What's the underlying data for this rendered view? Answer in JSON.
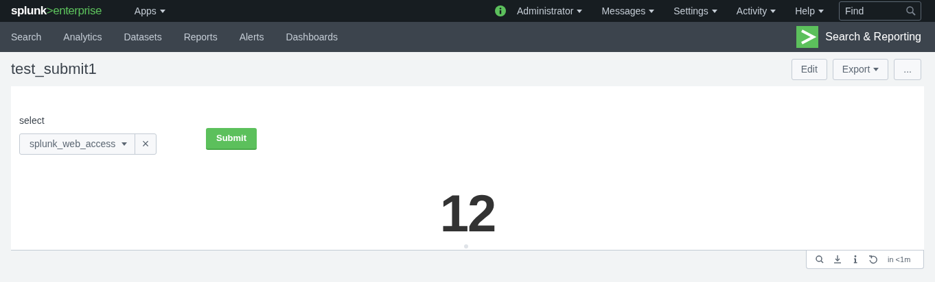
{
  "logo": {
    "brand": "splunk",
    "separator": ">",
    "product": "enterprise"
  },
  "top_menu": [
    {
      "label": "Apps",
      "dropdown": true
    }
  ],
  "account_menu": [
    {
      "label": "Administrator",
      "dropdown": true,
      "kind": "status"
    },
    {
      "label": "Messages",
      "dropdown": true
    },
    {
      "label": "Settings",
      "dropdown": true
    },
    {
      "label": "Activity",
      "dropdown": true
    },
    {
      "label": "Help",
      "dropdown": true
    }
  ],
  "search": {
    "placeholder": "Find"
  },
  "app_nav": [
    {
      "label": "Search"
    },
    {
      "label": "Analytics"
    },
    {
      "label": "Datasets"
    },
    {
      "label": "Reports"
    },
    {
      "label": "Alerts"
    },
    {
      "label": "Dashboards"
    }
  ],
  "app_name": "Search & Reporting",
  "dashboard": {
    "title": "test_submit1",
    "buttons": [
      {
        "label": "Edit",
        "dropdown": false
      },
      {
        "label": "Export",
        "dropdown": true
      },
      {
        "label": "...",
        "dropdown": false
      }
    ]
  },
  "inputs": [
    {
      "label": "select",
      "value": "splunk_web_access",
      "clear": "×"
    }
  ],
  "submit": "Submit",
  "single_value": "12",
  "panel_footer": {
    "refresh_time": "in <1m"
  }
}
